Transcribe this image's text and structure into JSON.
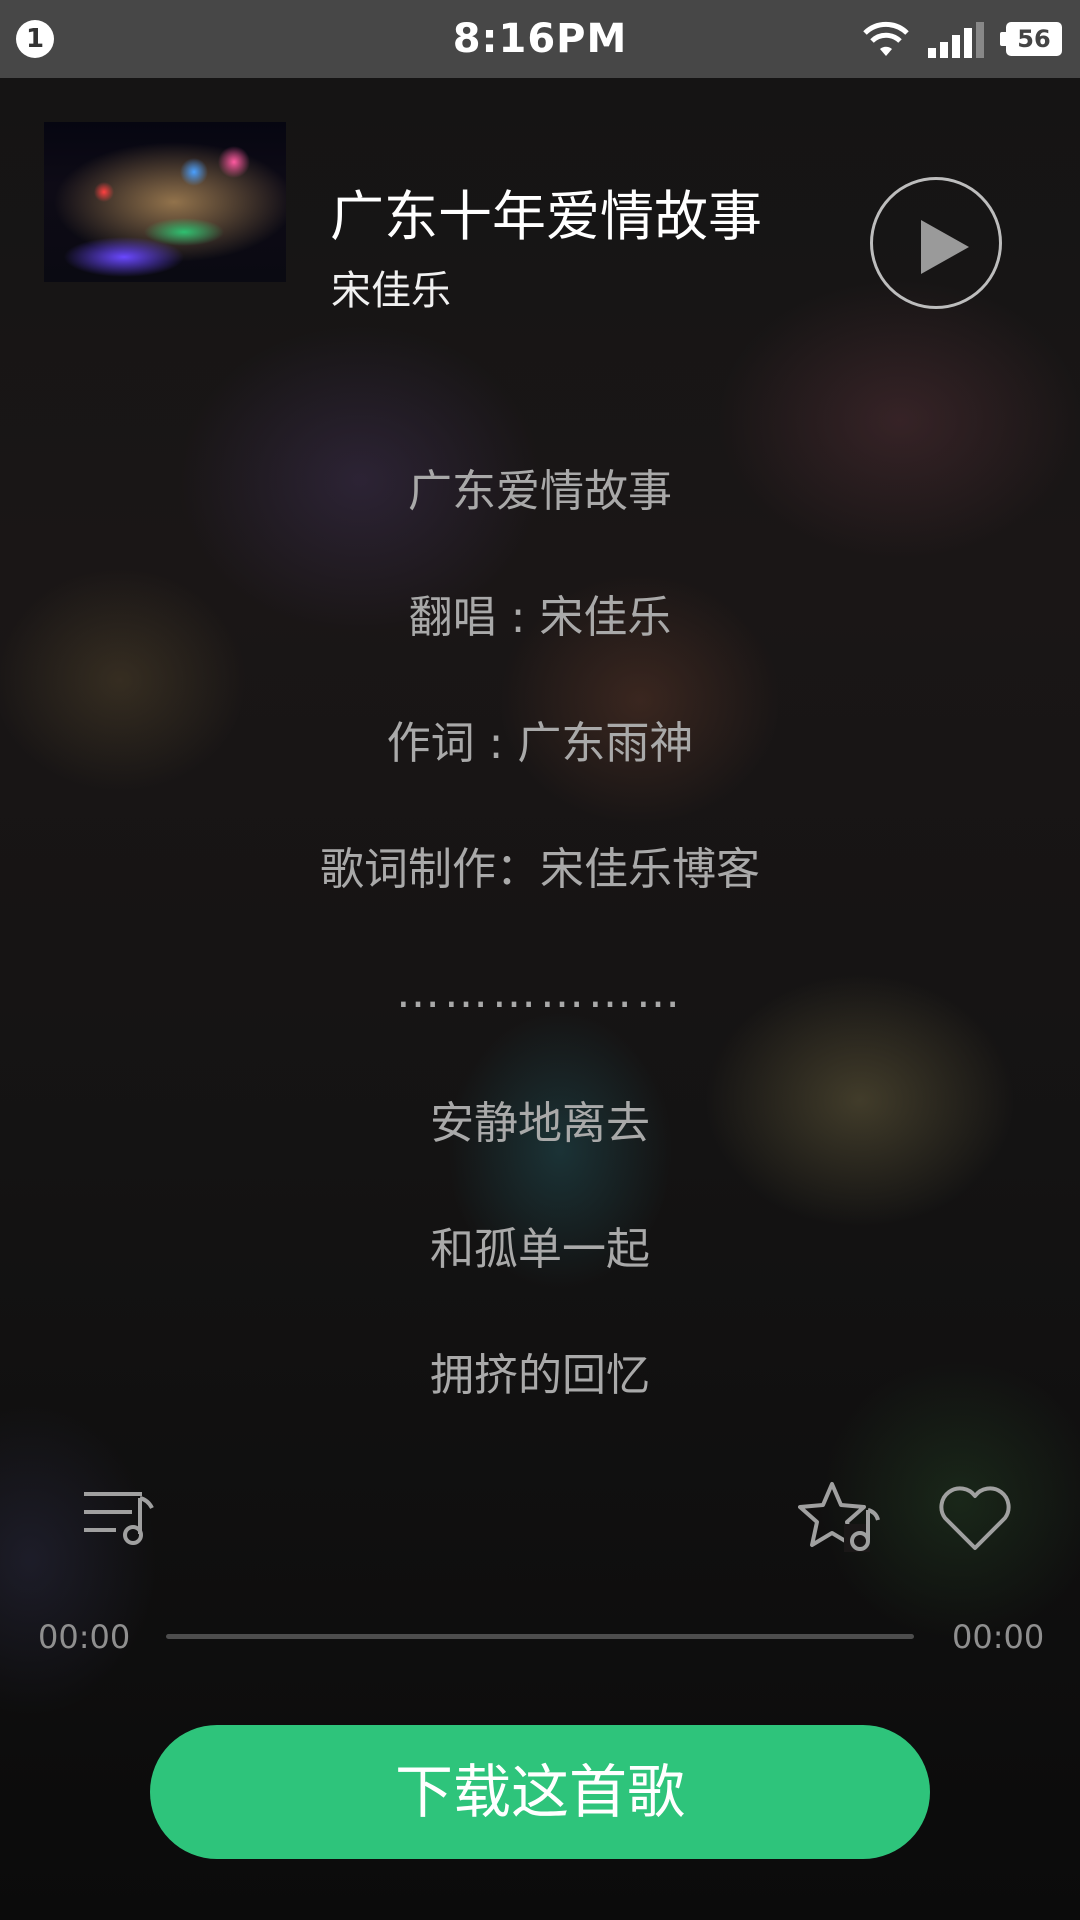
{
  "status_bar": {
    "notification_count": "1",
    "time": "8:16PM",
    "battery": "56",
    "icons": [
      "wifi-icon",
      "signal-icon",
      "battery-icon"
    ]
  },
  "now_playing": {
    "title": "广东十年爱情故事",
    "artist": "宋佳乐",
    "album_art": "night-city-skyline-image",
    "play_icon": "play-icon"
  },
  "lyrics": [
    "广东爱情故事",
    "翻唱 : 宋佳乐",
    "作词 : 广东雨神",
    "歌词制作：宋佳乐博客",
    "………………",
    "安静地离去",
    "和孤单一起",
    "拥挤的回忆"
  ],
  "actions": {
    "playlist_icon": "playlist-icon",
    "favorite_icon": "star-music-icon",
    "like_icon": "heart-icon"
  },
  "progress": {
    "current": "00:00",
    "total": "00:00",
    "fraction": 0
  },
  "download": {
    "label": "下载这首歌"
  },
  "colors": {
    "accent": "#2ec47b",
    "status_bar": "#474747",
    "lyrics_text": "#a9a9a9"
  }
}
